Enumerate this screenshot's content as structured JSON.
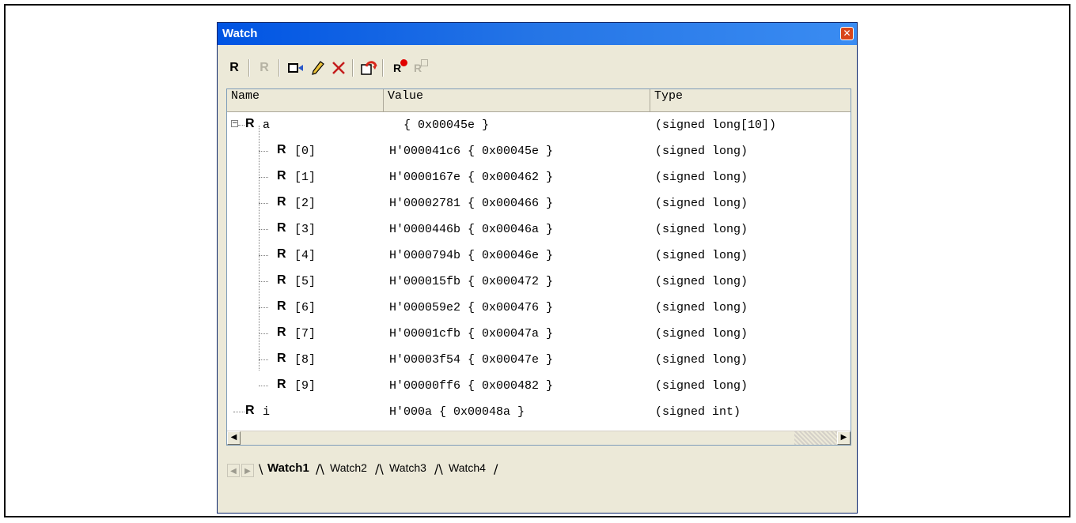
{
  "window": {
    "title": "Watch",
    "close_glyph": "✕"
  },
  "toolbar": [
    {
      "name": "add-watch-icon",
      "glyph": "R"
    },
    {
      "name": "remove-watch-icon",
      "glyph": "R"
    },
    {
      "name": "camera-icon",
      "glyph": "▭"
    },
    {
      "name": "pencil-icon",
      "glyph": "✎"
    },
    {
      "name": "delete-icon",
      "glyph": "✕"
    },
    {
      "name": "refresh-icon",
      "glyph": "♺"
    },
    {
      "name": "record-icon",
      "glyph": "R"
    },
    {
      "name": "record-disabled-icon",
      "glyph": "R"
    }
  ],
  "columns": {
    "name": "Name",
    "value": "Value",
    "type": "Type"
  },
  "rows": [
    {
      "name": "a",
      "value": "  { 0x00045e }",
      "type": "(signed long[10])",
      "expander": "−"
    },
    {
      "name": "[0]",
      "value": "H'000041c6 { 0x00045e }",
      "type": "(signed long)"
    },
    {
      "name": "[1]",
      "value": "H'0000167e { 0x000462 }",
      "type": "(signed long)"
    },
    {
      "name": "[2]",
      "value": "H'00002781 { 0x000466 }",
      "type": "(signed long)"
    },
    {
      "name": "[3]",
      "value": "H'0000446b { 0x00046a }",
      "type": "(signed long)"
    },
    {
      "name": "[4]",
      "value": "H'0000794b { 0x00046e }",
      "type": "(signed long)"
    },
    {
      "name": "[5]",
      "value": "H'000015fb { 0x000472 }",
      "type": "(signed long)"
    },
    {
      "name": "[6]",
      "value": "H'000059e2 { 0x000476 }",
      "type": "(signed long)"
    },
    {
      "name": "[7]",
      "value": "H'00001cfb { 0x00047a }",
      "type": "(signed long)"
    },
    {
      "name": "[8]",
      "value": "H'00003f54 { 0x00047e }",
      "type": "(signed long)"
    },
    {
      "name": "[9]",
      "value": "H'00000ff6 { 0x000482 }",
      "type": "(signed long)"
    },
    {
      "name": "i",
      "value": "H'000a { 0x00048a }",
      "type": "(signed int)"
    }
  ],
  "tabs": [
    "Watch1",
    "Watch2",
    "Watch3",
    "Watch4"
  ],
  "active_tab": "Watch1",
  "scroll": {
    "left": "◀",
    "right": "▶"
  },
  "nav": {
    "prev": "◀",
    "next": "▶"
  },
  "colors": {
    "title_bar": "#0054e3",
    "close_button": "#d9461b",
    "record_dot": "#e00000"
  }
}
